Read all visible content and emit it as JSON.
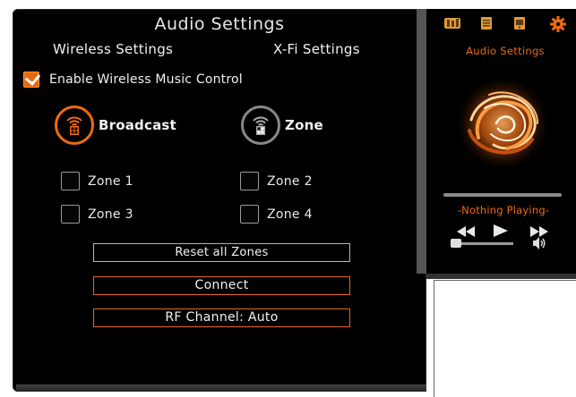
{
  "window": {
    "title": "Audio Settings"
  },
  "tabs": [
    {
      "label": "Wireless Settings"
    },
    {
      "label": "X-Fi Settings"
    }
  ],
  "enable_wireless": {
    "label": "Enable Wireless Music Control",
    "checked": true
  },
  "modes": {
    "broadcast": {
      "label": "Broadcast",
      "active": true
    },
    "zone": {
      "label": "Zone",
      "active": false
    }
  },
  "zones": [
    {
      "label": "Zone 1",
      "checked": false
    },
    {
      "label": "Zone 2",
      "checked": false
    },
    {
      "label": "Zone 3",
      "checked": false
    },
    {
      "label": "Zone 4",
      "checked": false
    }
  ],
  "buttons": {
    "reset": "Reset all Zones",
    "connect": "Connect",
    "rf_channel": "RF Channel: Auto"
  },
  "side_panel": {
    "title": "Audio Settings",
    "now_playing": "-Nothing Playing-",
    "icons": [
      "audio-mixer-icon",
      "playlist-icon",
      "device-icon",
      "settings-gear-icon"
    ]
  },
  "colors": {
    "accent": "#ee6a12",
    "background": "#000000",
    "text": "#f2f2f2"
  }
}
